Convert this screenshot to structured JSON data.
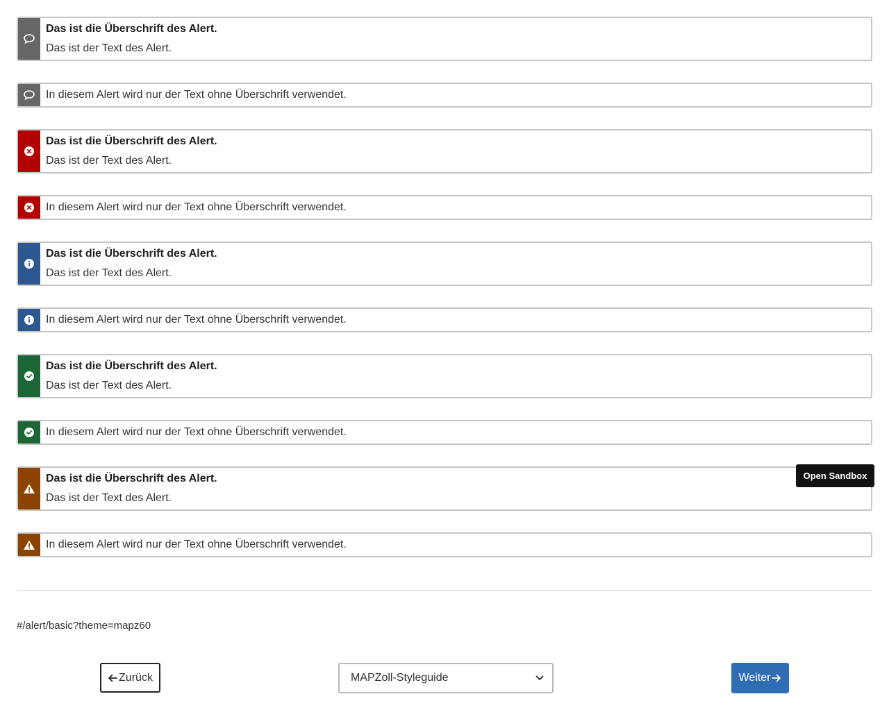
{
  "colors": {
    "neutral": "#666666",
    "error": "#b30000",
    "info": "#2c5791",
    "success": "#1a6634",
    "warning": "#8a4400",
    "primary_button": "#2f6db5"
  },
  "alerts": [
    {
      "variant": "neutral",
      "icon": "speech-bubble-icon",
      "heading": "Das ist die Überschrift des Alert.",
      "text": "Das ist der Text des Alert."
    },
    {
      "variant": "neutral",
      "icon": "speech-bubble-icon",
      "text": "In diesem Alert wird nur der Text ohne Überschrift verwendet."
    },
    {
      "variant": "error",
      "icon": "error-circle-icon",
      "heading": "Das ist die Überschrift des Alert.",
      "text": "Das ist der Text des Alert."
    },
    {
      "variant": "error",
      "icon": "error-circle-icon",
      "text": "In diesem Alert wird nur der Text ohne Überschrift verwendet."
    },
    {
      "variant": "info",
      "icon": "info-circle-icon",
      "heading": "Das ist die Überschrift des Alert.",
      "text": "Das ist der Text des Alert."
    },
    {
      "variant": "info",
      "icon": "info-circle-icon",
      "text": "In diesem Alert wird nur der Text ohne Überschrift verwendet."
    },
    {
      "variant": "success",
      "icon": "check-circle-icon",
      "heading": "Das ist die Überschrift des Alert.",
      "text": "Das ist der Text des Alert."
    },
    {
      "variant": "success",
      "icon": "check-circle-icon",
      "text": "In diesem Alert wird nur der Text ohne Überschrift verwendet."
    },
    {
      "variant": "warning",
      "icon": "warning-triangle-icon",
      "heading": "Das ist die Überschrift des Alert.",
      "text": "Das ist der Text des Alert."
    },
    {
      "variant": "warning",
      "icon": "warning-triangle-icon",
      "text": "In diesem Alert wird nur der Text ohne Überschrift verwendet."
    }
  ],
  "tooltip": {
    "label": "Open Sandbox"
  },
  "route": {
    "text": "#/alert/basic?theme=mapz60"
  },
  "nav": {
    "back_label": "Zurück",
    "next_label": "Weiter",
    "select_value": "MAPZoll-Styleguide"
  }
}
